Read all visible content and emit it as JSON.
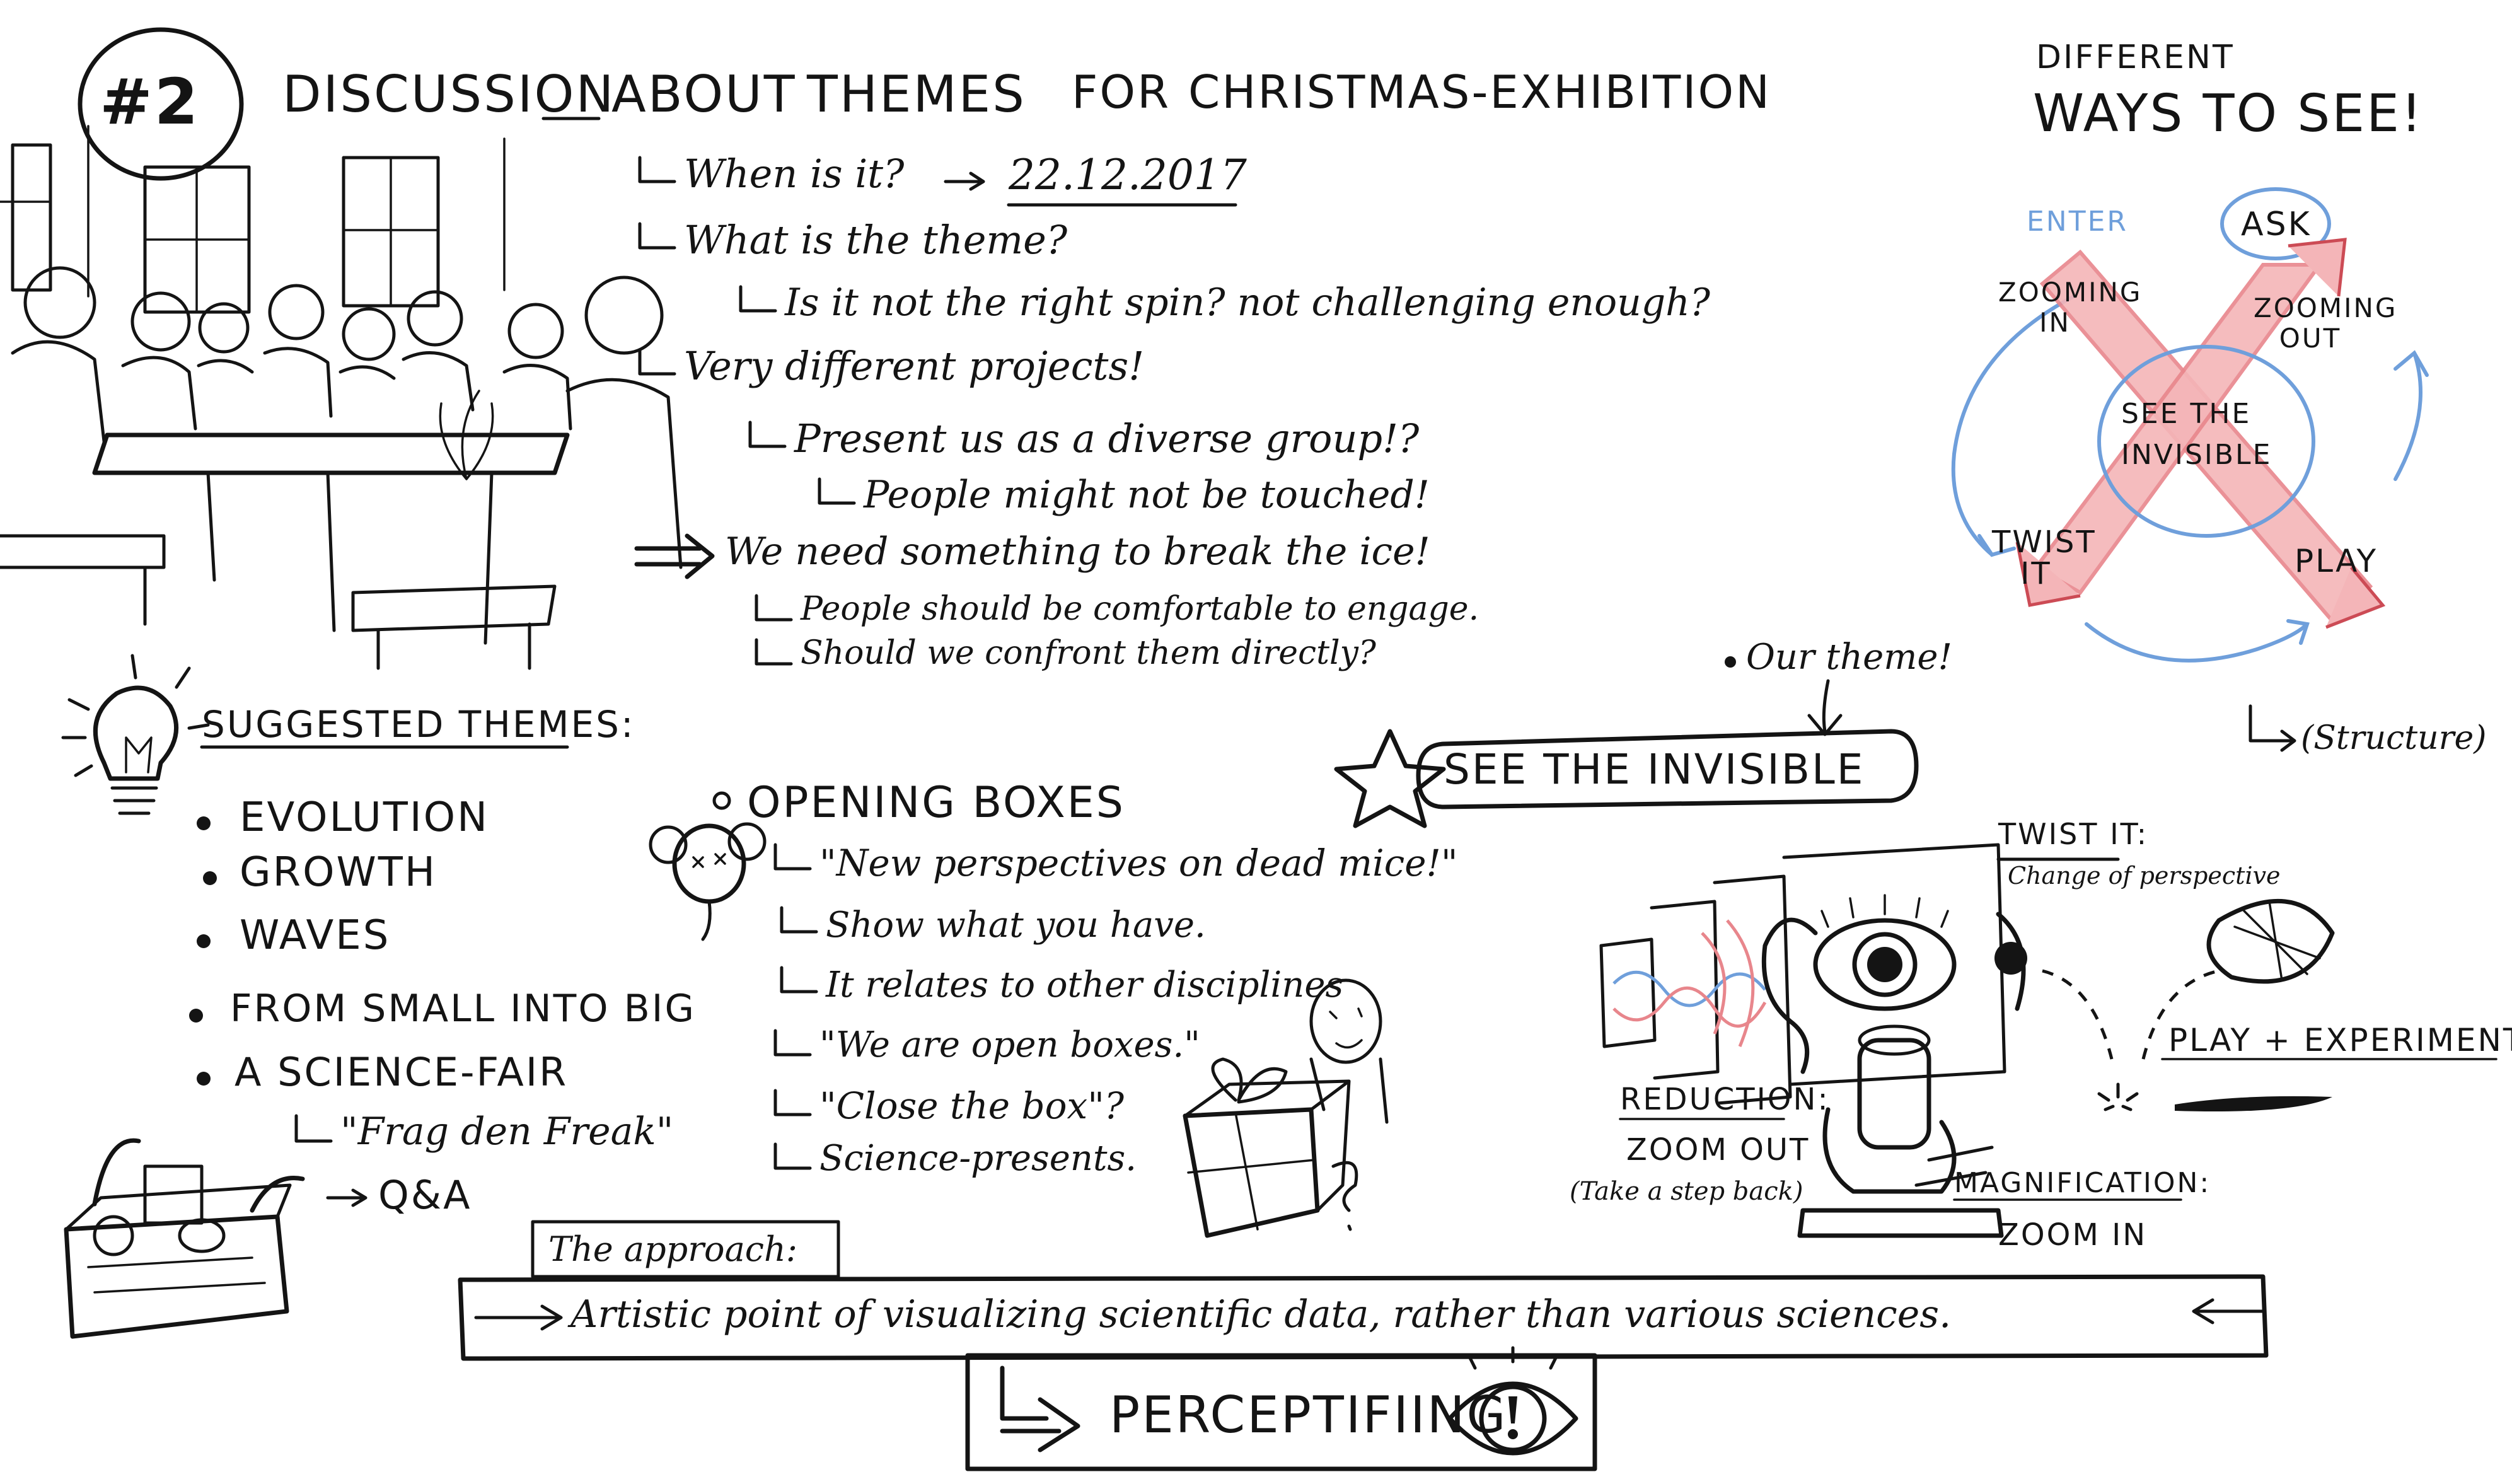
{
  "colors": {
    "ink": "#141414",
    "blue": "#6f9fdb",
    "red": "#e8868c",
    "red_fill": "#f4b5b8",
    "red_dark": "#cc4b55"
  },
  "header": {
    "number": "#2",
    "title_1": "DISCUSSION",
    "title_2": "ABOUT",
    "title_3": "THEMES",
    "title_4": "FOR",
    "title_5": "CHRISTMAS-EXHIBITION"
  },
  "questions": {
    "when": "When is it?",
    "date": "22.12.2017",
    "what": "What is the theme?",
    "spin": "Is it not the right spin? not challenging enough?",
    "projects": "Very different projects!",
    "present": "Present us as a diverse group!?",
    "touched": "People might not be touched!",
    "ice": "We need something to break the ice!",
    "comfortable": "People should be comfortable to engage.",
    "confront": "Should we confront them directly?"
  },
  "suggested": {
    "title": "SUGGESTED THEMES:",
    "items": [
      "EVOLUTION",
      "GROWTH",
      "WAVES",
      "FROM SMALL INTO BIG",
      "A SCIENCE-FAIR"
    ],
    "fair_sub": "\"Frag den Freak\"",
    "qa": "Q&A"
  },
  "boxes": {
    "title": "OPENING BOXES",
    "items": [
      "\"New perspectives on dead mice!\"",
      "Show what you have.",
      "It relates to other disciplines",
      "\"We are open boxes.\"",
      "\"Close the box\"?",
      "Science-presents."
    ]
  },
  "theme": {
    "our_label": "Our theme!",
    "name": "SEE THE INVISIBLE"
  },
  "ways": {
    "title_1": "DIFFERENT",
    "title_2": "WAYS TO SEE!",
    "enter": "ENTER",
    "ask": "ASK",
    "zoom_in": "ZOOMING IN",
    "zoom_out": "ZOOMING OUT",
    "center_1": "SEE THE",
    "center_2": "INVISIBLE",
    "twist": "TWIST IT",
    "play": "PLAY",
    "structure": "(Structure)"
  },
  "perspective": {
    "twist_title": "TWIST IT:",
    "twist_sub": "Change of perspective",
    "play": "PLAY + EXPERIMENT",
    "reduction": "REDUCTION:",
    "zoom_out": "ZOOM OUT",
    "step_back": "(Take a step back)",
    "magnification": "MAGNIFICATION:",
    "zoom_in": "ZOOM IN"
  },
  "approach": {
    "label": "The approach:",
    "text": "Artistic point of visualizing scientific data, rather than various sciences.",
    "result": "PERCEPTIFIING"
  }
}
